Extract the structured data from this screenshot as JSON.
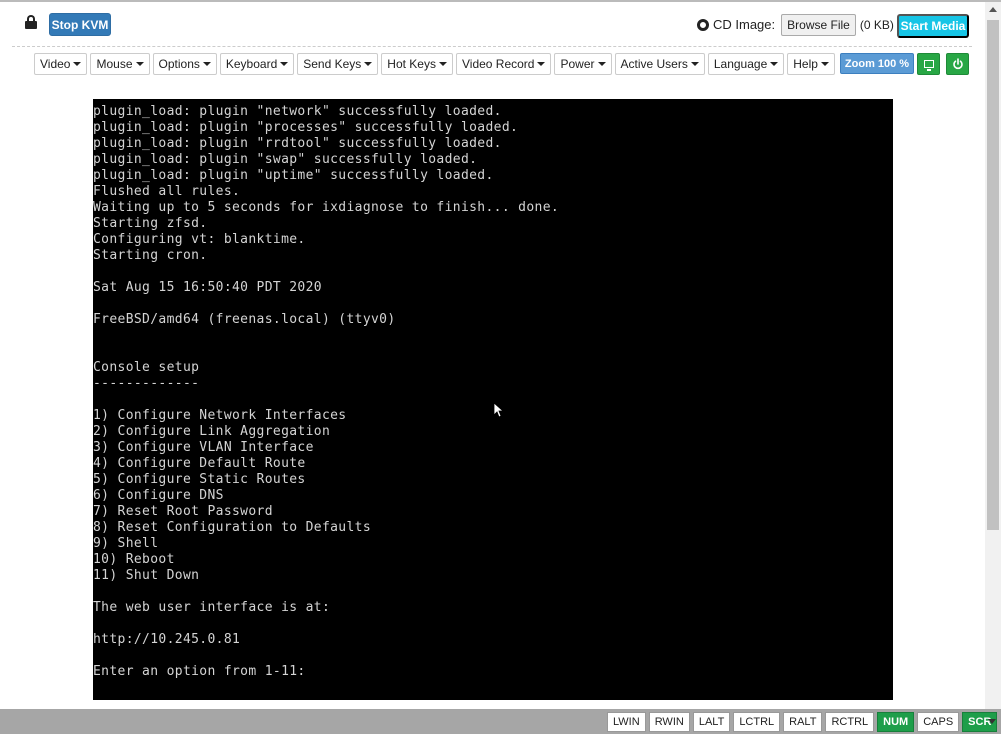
{
  "topbar": {
    "stop_kvm_label": "Stop KVM",
    "cd_image_label": "CD Image:",
    "browse_file_label": "Browse File",
    "file_size": "(0 KB)",
    "start_media_label": "Start Media"
  },
  "menubar": {
    "items": [
      {
        "label": "Video"
      },
      {
        "label": "Mouse"
      },
      {
        "label": "Options"
      },
      {
        "label": "Keyboard"
      },
      {
        "label": "Send Keys"
      },
      {
        "label": "Hot Keys"
      },
      {
        "label": "Video Record"
      },
      {
        "label": "Power"
      },
      {
        "label": "Active Users"
      },
      {
        "label": "Language"
      },
      {
        "label": "Help"
      }
    ],
    "zoom_label": "Zoom 100 %"
  },
  "console": {
    "lines": [
      "plugin_load: plugin \"network\" successfully loaded.",
      "plugin_load: plugin \"processes\" successfully loaded.",
      "plugin_load: plugin \"rrdtool\" successfully loaded.",
      "plugin_load: plugin \"swap\" successfully loaded.",
      "plugin_load: plugin \"uptime\" successfully loaded.",
      "Flushed all rules.",
      "Waiting up to 5 seconds for ixdiagnose to finish... done.",
      "Starting zfsd.",
      "Configuring vt: blanktime.",
      "Starting cron.",
      "",
      "Sat Aug 15 16:50:40 PDT 2020",
      "",
      "FreeBSD/amd64 (freenas.local) (ttyv0)",
      "",
      "",
      "Console setup",
      "-------------",
      "",
      "1) Configure Network Interfaces",
      "2) Configure Link Aggregation",
      "3) Configure VLAN Interface",
      "4) Configure Default Route",
      "5) Configure Static Routes",
      "6) Configure DNS",
      "7) Reset Root Password",
      "8) Reset Configuration to Defaults",
      "9) Shell",
      "10) Reboot",
      "11) Shut Down",
      "",
      "The web user interface is at:",
      "",
      "http://10.245.0.81",
      "",
      "Enter an option from 1-11:"
    ]
  },
  "statusbar": {
    "keys": [
      {
        "label": "LWIN",
        "active": false
      },
      {
        "label": "RWIN",
        "active": false
      },
      {
        "label": "LALT",
        "active": false
      },
      {
        "label": "LCTRL",
        "active": false
      },
      {
        "label": "RALT",
        "active": false
      },
      {
        "label": "RCTRL",
        "active": false
      },
      {
        "label": "NUM",
        "active": true
      },
      {
        "label": "CAPS",
        "active": false
      },
      {
        "label": "SCR",
        "active": true
      }
    ]
  },
  "colors": {
    "stop_kvm": "#337ab7",
    "start_media": "#17c5e6",
    "zoom": "#5b9bd5",
    "green": "#28a745",
    "console_bg": "#000000",
    "console_fg": "#d4d4d4"
  },
  "icons": [
    "lock-icon",
    "cd-disc-icon",
    "caret-down-icon",
    "monitor-icon",
    "power-icon",
    "mouse-cursor-icon"
  ]
}
